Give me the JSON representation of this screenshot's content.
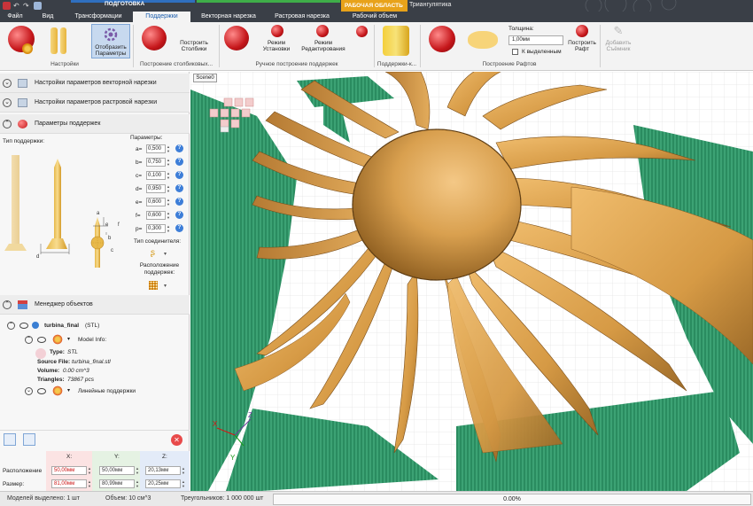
{
  "titlebar": {
    "context_prep": "ПОДГОТОВКА",
    "context_green": "",
    "context_workspace": "РАБОЧАЯ ОБЛАСТЬ",
    "title": "Триангулятика",
    "min": "–",
    "max": "□",
    "close": "✕"
  },
  "tabs": [
    {
      "label": "Файл"
    },
    {
      "label": "Вид"
    },
    {
      "label": "Трансформации"
    },
    {
      "label": "Поддержки"
    },
    {
      "label": "Векторная нарезка"
    },
    {
      "label": "Растровая нарезка"
    },
    {
      "label": "Рабочий объем"
    }
  ],
  "ribbon": {
    "show_params": "Отобразить Параметры",
    "build_pillars": "Построить Столбики",
    "install_mode": "Режим Установки",
    "edit_mode": "Режим Редактирования",
    "thickness_label": "Толщина:",
    "thickness_value": "1,00мм",
    "to_selected": "К выделенным",
    "build_raft": "Построить Рафт",
    "add_removable": "Добавить Съёмник",
    "groups": {
      "settings": "Настройки",
      "pillars": "Построение столбиковых...",
      "manual": "Ручное построение поддержек",
      "supports_k": "Поддержки-к...",
      "rafts": "Построение Рафтов"
    }
  },
  "panel": {
    "vector_settings": "Настройки параметров векторной нарезки",
    "raster_settings": "Настройки параметров растровой нарезки",
    "support_params": "Параметры поддержек",
    "support_type": "Тип поддержки:",
    "params_label": "Параметры:",
    "dims": {
      "a": "a",
      "b": "b",
      "c": "c",
      "d": "d",
      "e": "e",
      "f": "f"
    },
    "params": [
      {
        "name": "a=",
        "value": "0,500"
      },
      {
        "name": "b=",
        "value": "0,750"
      },
      {
        "name": "c=",
        "value": "0,100"
      },
      {
        "name": "d=",
        "value": "0,950"
      },
      {
        "name": "e=",
        "value": "0,600"
      },
      {
        "name": "f=",
        "value": "0,600"
      },
      {
        "name": "p=",
        "value": "0,300"
      }
    ],
    "connection_type": "Тип соединителя:",
    "placement": "Расположение поддержек:",
    "object_manager": "Менеджер объектов",
    "object_name": "turbina_final",
    "object_ext": "(STL)",
    "model_info": "Model Info:",
    "info": {
      "type_label": "Type:",
      "type_value": "STL",
      "source_label": "Source File:",
      "source_value": "turbina_final.stl",
      "volume_label": "Volume:",
      "volume_value": "0.00 cm^3",
      "triangles_label": "Triangles:",
      "triangles_value": "73867 pcs"
    },
    "linear_supports": "Линейные поддержки",
    "coords": {
      "x_label": "X:",
      "y_label": "Y:",
      "z_label": "Z:",
      "position_label": "Расположение",
      "size_label": "Размер:",
      "pos_x": "50,00мм",
      "pos_y": "50,00мм",
      "pos_z": "20,13мм",
      "size_x": "81,00мм",
      "size_y": "80,99мм",
      "size_z": "20,25мм"
    }
  },
  "viewport": {
    "scene_tab": "Scene0",
    "axes": {
      "x": "X",
      "y": "Y",
      "z": "Z"
    }
  },
  "status": {
    "selected": "Моделей выделено: 1 шт",
    "volume": "Объем: 10 см^3",
    "triangles": "Треугольников: 1 000 000 шт",
    "progress": "0.00%",
    "progress_fraction": 0.0
  },
  "colors": {
    "accent": "#1e5fae",
    "model": "#d9a24e",
    "supports": "#2f9a6a",
    "context_green": "#3fae49",
    "context_orange": "#e8a21a"
  }
}
